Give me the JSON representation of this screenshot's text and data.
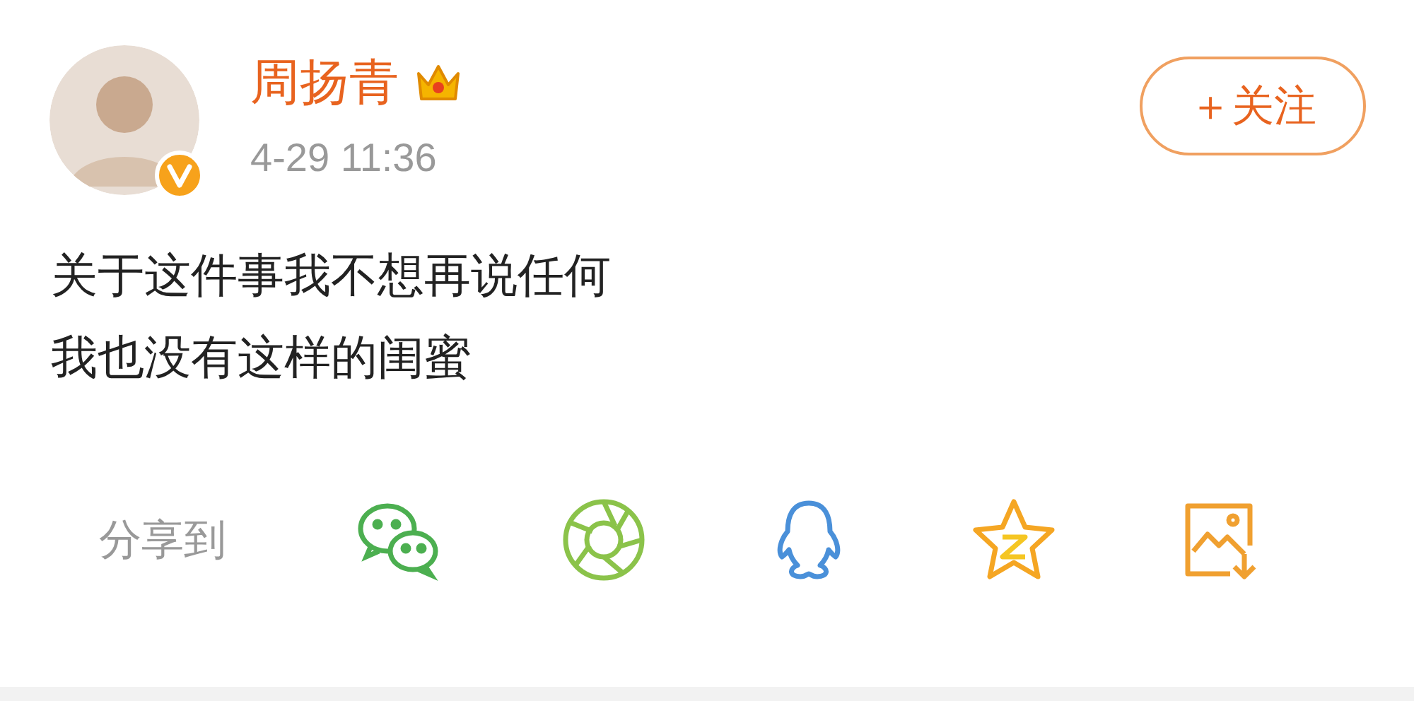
{
  "author": {
    "name": "周扬青",
    "time": "4-29 11:36",
    "verified": true,
    "member": true
  },
  "follow_button": {
    "label": "＋关注"
  },
  "post": {
    "lines": [
      "关于这件事我不想再说任何",
      "我也没有这样的闺蜜"
    ]
  },
  "share": {
    "label": "分享到",
    "targets": [
      {
        "kind": "wechat"
      },
      {
        "kind": "moments"
      },
      {
        "kind": "qq"
      },
      {
        "kind": "qzone"
      },
      {
        "kind": "save_image"
      }
    ]
  }
}
